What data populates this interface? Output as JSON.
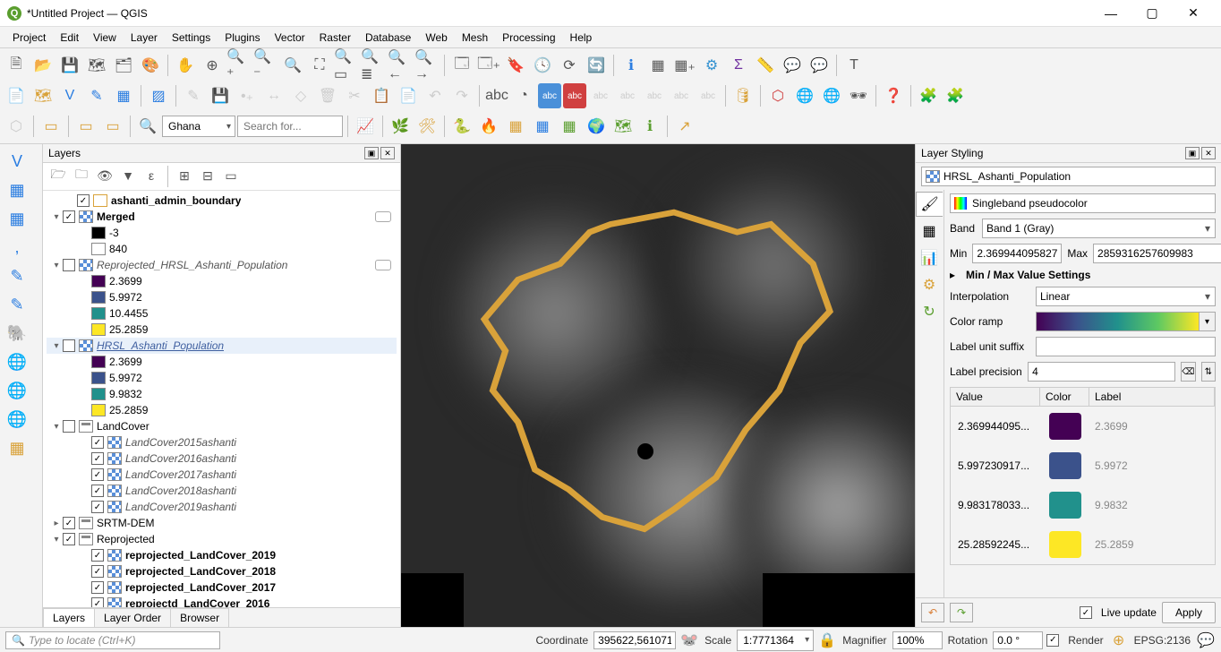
{
  "window": {
    "title": "*Untitled Project — QGIS"
  },
  "menu": [
    "Project",
    "Edit",
    "View",
    "Layer",
    "Settings",
    "Plugins",
    "Vector",
    "Raster",
    "Database",
    "Web",
    "Mesh",
    "Processing",
    "Help"
  ],
  "toolbar": {
    "location_combo": "Ghana",
    "search_placeholder": "Search for..."
  },
  "layers_panel": {
    "title": "Layers",
    "tabs": [
      "Layers",
      "Layer Order",
      "Browser"
    ],
    "active_tab": 0
  },
  "tree": [
    {
      "indent": 1,
      "exp": "",
      "chk": true,
      "icon": "poly",
      "label": "ashanti_admin_boundary",
      "bold": true
    },
    {
      "indent": 0,
      "exp": "▾",
      "chk": true,
      "icon": "raster",
      "label": "Merged",
      "bold": true,
      "chip": true
    },
    {
      "indent": 2,
      "swatch": "#000000",
      "label": "-3"
    },
    {
      "indent": 2,
      "swatch": "#ffffff",
      "label": "840"
    },
    {
      "indent": 0,
      "exp": "▾",
      "chk": false,
      "icon": "raster",
      "label": "Reprojected_HRSL_Ashanti_Population",
      "ital": true,
      "chip": true
    },
    {
      "indent": 2,
      "swatch": "#440154",
      "label": "2.3699"
    },
    {
      "indent": 2,
      "swatch": "#3b528b",
      "label": "5.9972"
    },
    {
      "indent": 2,
      "swatch": "#21918c",
      "label": "10.4455"
    },
    {
      "indent": 2,
      "swatch": "#fde725",
      "label": "25.2859"
    },
    {
      "indent": 0,
      "exp": "▾",
      "chk": false,
      "icon": "raster",
      "label": "HRSL_Ashanti_Population",
      "link": true,
      "sel": true
    },
    {
      "indent": 2,
      "swatch": "#440154",
      "label": "2.3699"
    },
    {
      "indent": 2,
      "swatch": "#3b528b",
      "label": "5.9972"
    },
    {
      "indent": 2,
      "swatch": "#21918c",
      "label": "9.9832"
    },
    {
      "indent": 2,
      "swatch": "#fde725",
      "label": "25.2859"
    },
    {
      "indent": 0,
      "exp": "▾",
      "chk": false,
      "icon": "group",
      "label": "LandCover"
    },
    {
      "indent": 2,
      "chk": true,
      "icon": "raster",
      "label": "LandCover2015ashanti",
      "ital": true
    },
    {
      "indent": 2,
      "chk": true,
      "icon": "raster",
      "label": "LandCover2016ashanti",
      "ital": true
    },
    {
      "indent": 2,
      "chk": true,
      "icon": "raster",
      "label": "LandCover2017ashanti",
      "ital": true
    },
    {
      "indent": 2,
      "chk": true,
      "icon": "raster",
      "label": "LandCover2018ashanti",
      "ital": true
    },
    {
      "indent": 2,
      "chk": true,
      "icon": "raster",
      "label": "LandCover2019ashanti",
      "ital": true
    },
    {
      "indent": 0,
      "exp": "▸",
      "chk": true,
      "icon": "group",
      "label": "SRTM-DEM"
    },
    {
      "indent": 0,
      "exp": "▾",
      "chk": true,
      "icon": "group",
      "label": "Reprojected"
    },
    {
      "indent": 2,
      "chk": true,
      "icon": "raster",
      "label": "reprojected_LandCover_2019",
      "bold": true
    },
    {
      "indent": 2,
      "chk": true,
      "icon": "raster",
      "label": "reprojected_LandCover_2018",
      "bold": true
    },
    {
      "indent": 2,
      "chk": true,
      "icon": "raster",
      "label": "reprojected_LandCover_2017",
      "bold": true
    },
    {
      "indent": 2,
      "chk": true,
      "icon": "raster",
      "label": "reprojectd_LandCover_2016",
      "bold": true
    }
  ],
  "styling": {
    "title": "Layer Styling",
    "layer": "HRSL_Ashanti_Population",
    "renderer": "Singleband pseudocolor",
    "band_label": "Band",
    "band": "Band 1 (Gray)",
    "min_label": "Min",
    "min": "2.3699440958275",
    "max_label": "Max",
    "max": "2859316257609983",
    "minmax_settings": "Min / Max Value Settings",
    "interp_label": "Interpolation",
    "interp": "Linear",
    "ramp_label": "Color ramp",
    "suffix_label": "Label unit suffix",
    "suffix": "",
    "precision_label": "Label precision",
    "precision": "4",
    "col_value": "Value",
    "col_color": "Color",
    "col_label": "Label",
    "rows": [
      {
        "value": "2.369944095...",
        "color": "#440154",
        "label": "2.3699"
      },
      {
        "value": "5.997230917...",
        "color": "#3b528b",
        "label": "5.9972"
      },
      {
        "value": "9.983178033...",
        "color": "#21918c",
        "label": "9.9832"
      },
      {
        "value": "25.28592245...",
        "color": "#fde725",
        "label": "25.2859"
      }
    ],
    "live_update": "Live update",
    "apply": "Apply"
  },
  "status": {
    "locator": "Type to locate (Ctrl+K)",
    "coord_label": "Coordinate",
    "coord": "395622,561071",
    "scale_label": "Scale",
    "scale": "1:7771364",
    "mag_label": "Magnifier",
    "mag": "100%",
    "rot_label": "Rotation",
    "rot": "0.0 °",
    "render": "Render",
    "crs": "EPSG:2136"
  }
}
